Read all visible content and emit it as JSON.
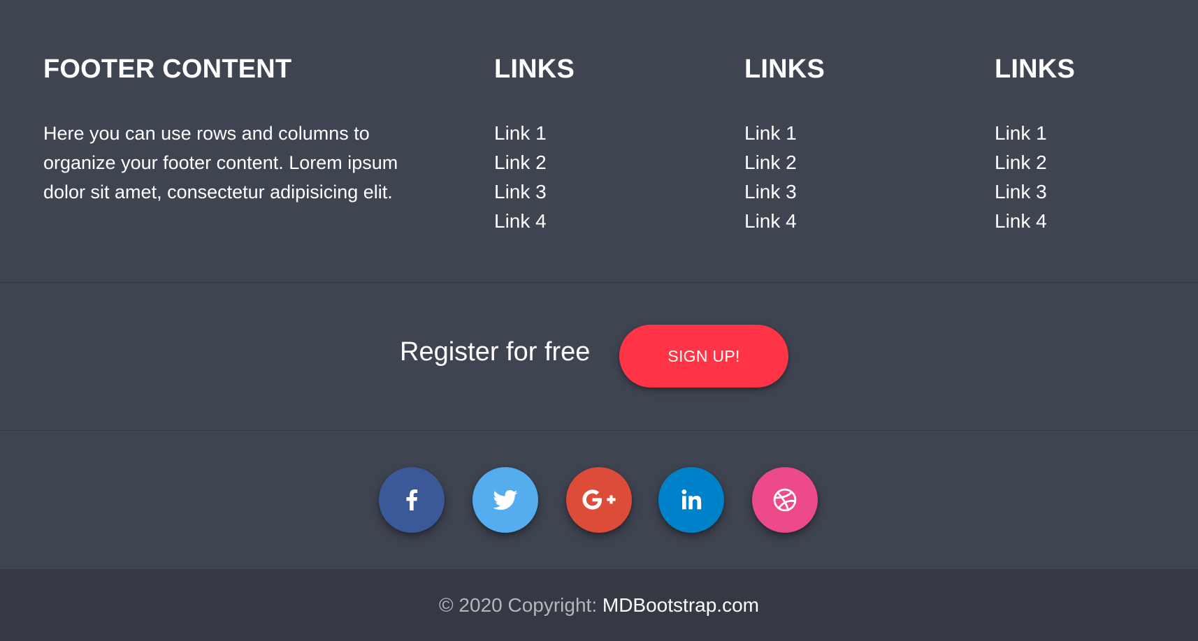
{
  "about": {
    "heading": "FOOTER CONTENT",
    "text": "Here you can use rows and columns to organize your footer content. Lorem ipsum dolor sit amet, consectetur adipisicing elit."
  },
  "link_columns": [
    {
      "heading": "LINKS",
      "items": [
        "Link 1",
        "Link 2",
        "Link 3",
        "Link 4"
      ]
    },
    {
      "heading": "LINKS",
      "items": [
        "Link 1",
        "Link 2",
        "Link 3",
        "Link 4"
      ]
    },
    {
      "heading": "LINKS",
      "items": [
        "Link 1",
        "Link 2",
        "Link 3",
        "Link 4"
      ]
    }
  ],
  "register": {
    "text": "Register for free",
    "button_label": "SIGN UP!",
    "button_color": "#ff3547"
  },
  "social": [
    {
      "icon": "facebook-icon",
      "color": "#3b5998"
    },
    {
      "icon": "twitter-icon",
      "color": "#55acee"
    },
    {
      "icon": "google-plus-icon",
      "color": "#dd4b39"
    },
    {
      "icon": "linkedin-icon",
      "color": "#0082ca"
    },
    {
      "icon": "dribbble-icon",
      "color": "#ec4a89"
    }
  ],
  "copyright": {
    "prefix": "© 2020 Copyright: ",
    "link_text": "MDBootstrap.com"
  },
  "colors": {
    "background": "#3f4451",
    "copyright_background": "#353944"
  }
}
